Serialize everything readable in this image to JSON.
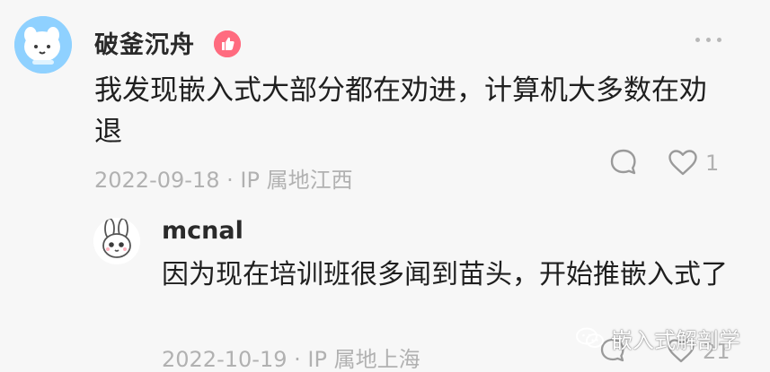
{
  "comment": {
    "author": "破釜沉舟",
    "text": "我发现嵌入式大部分都在劝进，计算机大多数在劝退",
    "date": "2022-09-18",
    "separator": "·",
    "ip": "IP 属地江西",
    "likes": "1",
    "badge_icon": "thumb-up-icon",
    "badge_color": "#ff6b7f"
  },
  "reply": {
    "author": "mcnal",
    "text": "因为现在培训班很多闻到苗头，开始推嵌入式了",
    "date": "2022-10-19",
    "separator": "·",
    "ip": "IP 属地上海",
    "likes": "21"
  },
  "watermark": {
    "text": "嵌入式解剖学"
  },
  "colors": {
    "background": "#f7f7f7",
    "meta_text": "#b1b1b1",
    "main_text": "#1f1f1f"
  }
}
